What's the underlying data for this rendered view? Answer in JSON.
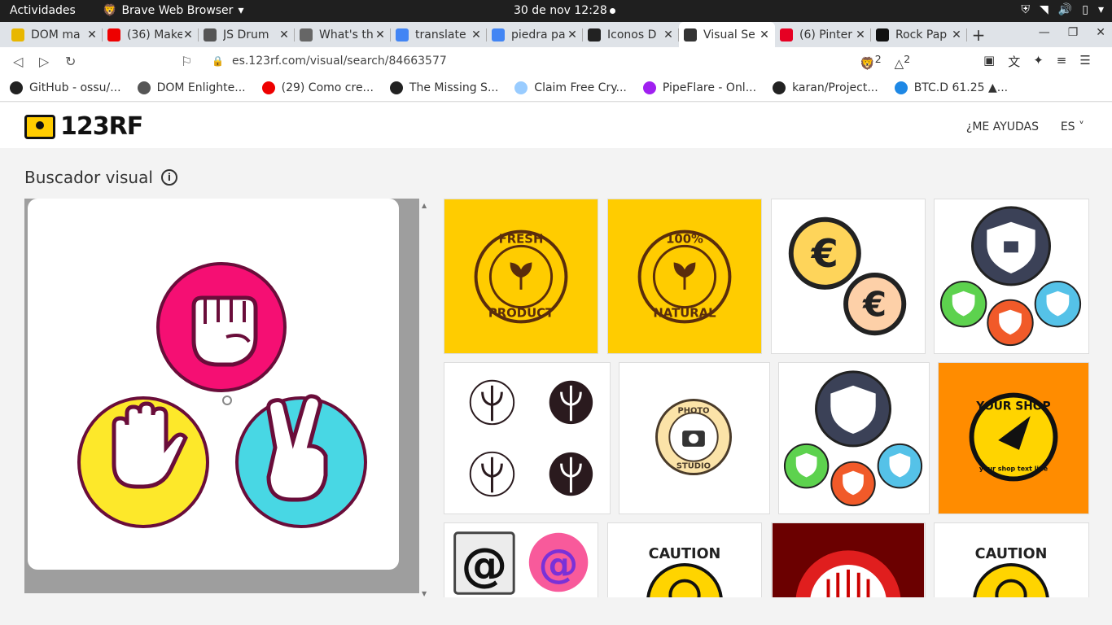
{
  "os": {
    "activities": "Actividades",
    "app_name": "Brave Web Browser",
    "clock": "30 de nov  12:28"
  },
  "tabs": [
    {
      "label": "DOM ma",
      "fav": "#e8b700"
    },
    {
      "label": "(36) Make",
      "fav": "#e00"
    },
    {
      "label": "JS Drum",
      "fav": "#555"
    },
    {
      "label": "What's th",
      "fav": "#666"
    },
    {
      "label": "translate",
      "fav": "#4285f4"
    },
    {
      "label": "piedra pa",
      "fav": "#4285f4"
    },
    {
      "label": "Iconos D",
      "fav": "#222"
    },
    {
      "label": "Visual Se",
      "fav": "#333"
    },
    {
      "label": "(6) Pinter",
      "fav": "#e60023"
    },
    {
      "label": "Rock Pap",
      "fav": "#111"
    }
  ],
  "navbar": {
    "url": "es.123rf.com/visual/search/84663577",
    "brave_badge": "2",
    "rewards_badge": "2"
  },
  "bookmarks": [
    {
      "label": "GitHub - ossu/...",
      "color": "#222"
    },
    {
      "label": "DOM Enlighte...",
      "color": "#555"
    },
    {
      "label": "(29) Como cre...",
      "color": "#e00"
    },
    {
      "label": "The Missing S...",
      "color": "#222"
    },
    {
      "label": "Claim Free Cry...",
      "color": "#9cf"
    },
    {
      "label": "PipeFlare - Onl...",
      "color": "#a020f0"
    },
    {
      "label": "karan/Project...",
      "color": "#222"
    },
    {
      "label": "BTC.D 61.25 ▲...",
      "color": "#1e88e5"
    }
  ],
  "site": {
    "logo_text": "123RF",
    "help_label": "¿ME AYUDAS",
    "lang_label": "ES",
    "page_title": "Buscador visual",
    "info_icon": "i"
  },
  "results": [
    {
      "kind": "badge",
      "bg": "#ffcc00",
      "text_top": "FRESH",
      "text_bottom": "PRODUCT"
    },
    {
      "kind": "badge",
      "bg": "#ffcc00",
      "text_top": "100%",
      "text_bottom": "NATURAL"
    },
    {
      "kind": "euro",
      "bg": "#ffffff",
      "symbol": "€"
    },
    {
      "kind": "shields",
      "bg": "#ffffff"
    },
    {
      "kind": "tridents",
      "bg": "#ffffff"
    },
    {
      "kind": "photo",
      "bg": "#ffffff",
      "text_top": "PHOTO",
      "text_bottom": "STUDIO"
    },
    {
      "kind": "shields2",
      "bg": "#ffffff"
    },
    {
      "kind": "shop",
      "bg": "#ff8c00",
      "text_top": "YOUR SHOP",
      "text_bottom": "your shop text line"
    },
    {
      "kind": "at",
      "bg": "#ffffff",
      "symbol": "@"
    },
    {
      "kind": "caution",
      "bg": "#ffffff",
      "label": "CAUTION"
    },
    {
      "kind": "circuit",
      "bg": "#6b0000"
    },
    {
      "kind": "caution",
      "bg": "#ffffff",
      "label": "CAUTION"
    }
  ],
  "colors": {
    "rock": "#f50f73",
    "paper": "#fde82a",
    "scissors": "#48d7e4",
    "stroke": "#6a0d3a",
    "brand": "#ffcc00"
  }
}
